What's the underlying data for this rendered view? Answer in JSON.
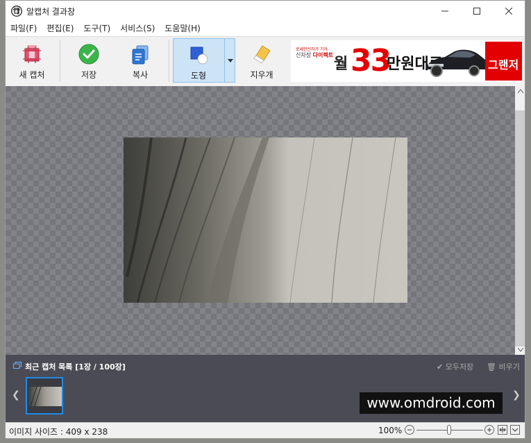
{
  "window": {
    "title": "알캡처 결과창"
  },
  "menu": [
    {
      "label": "파일(F)"
    },
    {
      "label": "편집(E)"
    },
    {
      "label": "도구(T)"
    },
    {
      "label": "서비스(S)"
    },
    {
      "label": "도움말(H)"
    }
  ],
  "toolbar": {
    "new_capture": "새 캡처",
    "save": "저장",
    "copy": "복사",
    "shape": "도형",
    "eraser": "지우개"
  },
  "ad": {
    "small": "로새한신차가 기아",
    "line2_prefix": "신차장",
    "line2_bold": "다이렉트",
    "month": "월",
    "amount": "33",
    "unit": "만원대로",
    "badge": "그랜저"
  },
  "image": {
    "width": 409,
    "height": 238
  },
  "recent": {
    "title": "최근 캡처 목록 [1장 / 100장]",
    "save_all": "모두저장",
    "clear": "비우기"
  },
  "watermark": "www.omdroid.com",
  "status": {
    "size_text": "이미지 사이즈 : 409 x 238",
    "zoom": "100%"
  },
  "colors": {
    "accent": "#1e8ce6",
    "panel": "#4b4b55",
    "ad_red": "#e30000"
  }
}
